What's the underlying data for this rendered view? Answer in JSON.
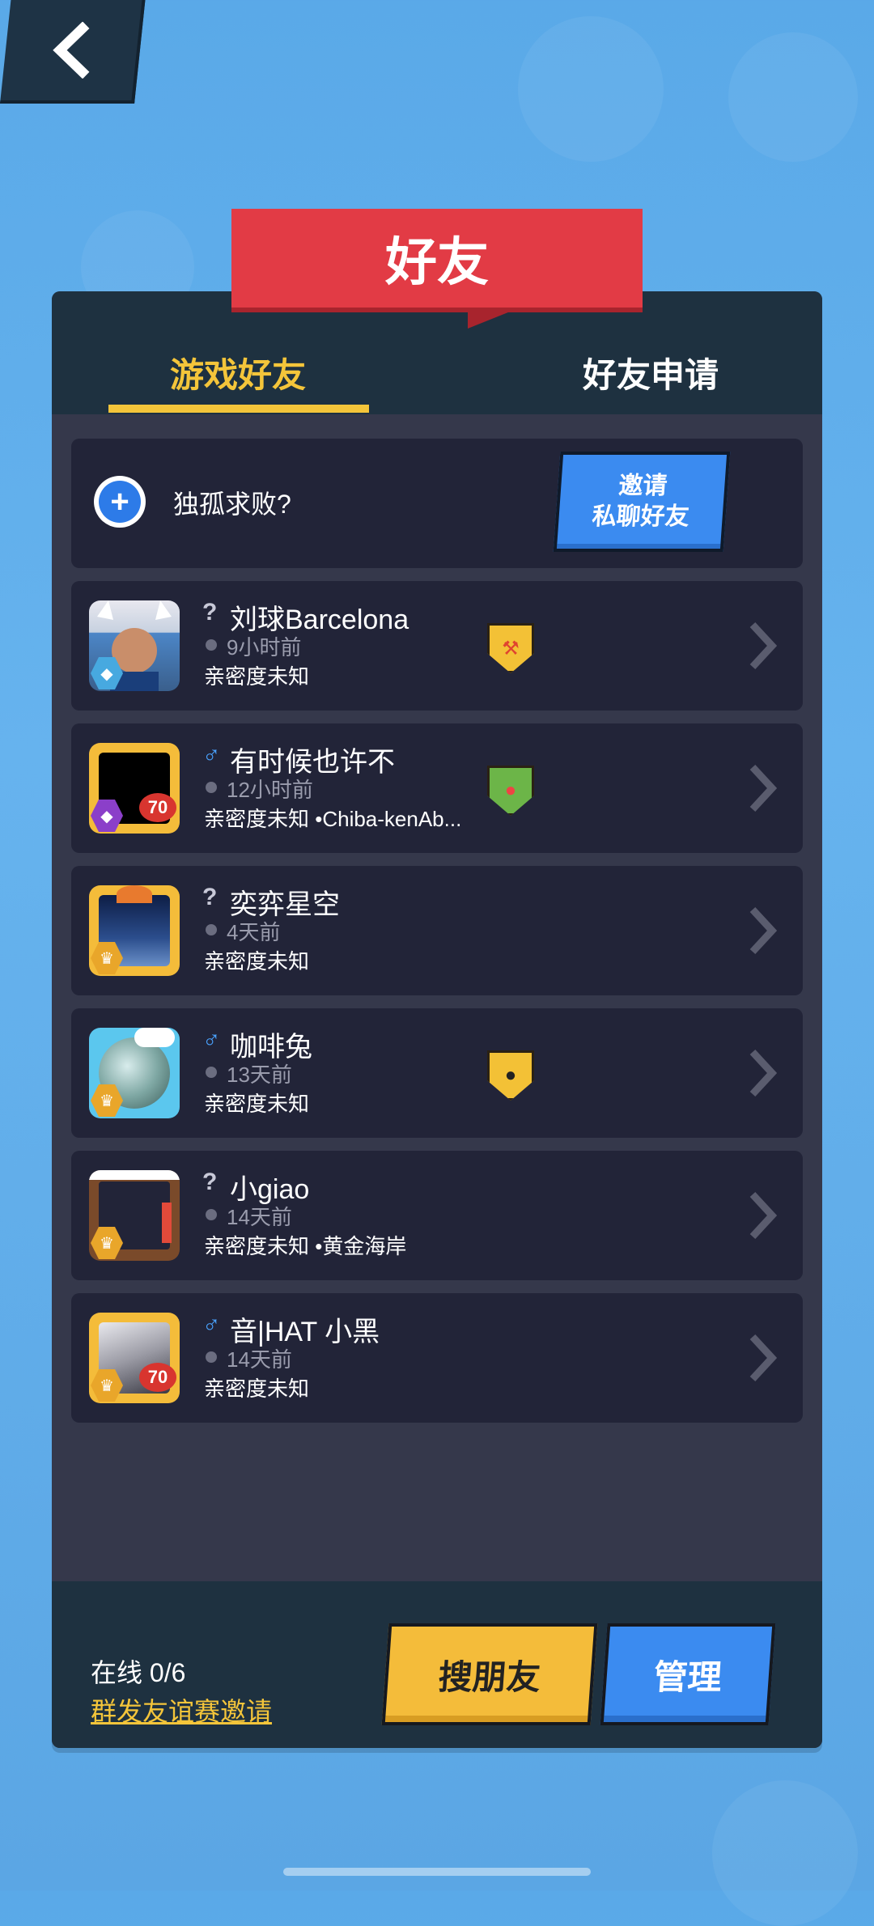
{
  "header": {
    "title": "好友"
  },
  "tabs": [
    {
      "label": "游戏好友",
      "active": true
    },
    {
      "label": "好友申请",
      "active": false
    }
  ],
  "invite": {
    "prompt": "独孤求败?",
    "button_line1": "邀请",
    "button_line2": "私聊好友"
  },
  "friends": [
    {
      "gender": "?",
      "name": "刘球Barcelona",
      "time": "9小时前",
      "intimacy": "亲密度未知",
      "avatar_icon": "player-avatar-cat-hat-icon",
      "badge_icon": "hammer-shield-icon"
    },
    {
      "gender": "♂",
      "name": "有时候也许不",
      "time": "12小时前",
      "intimacy": "亲密度未知 •Chiba-kenAb...",
      "avatar_icon": "black-avatar-icon",
      "badge_icon": "ladybug-shield-icon"
    },
    {
      "gender": "?",
      "name": "奕弈星空",
      "time": "4天前",
      "intimacy": "亲密度未知",
      "avatar_icon": "night-city-avatar-icon",
      "badge_icon": ""
    },
    {
      "gender": "♂",
      "name": "咖啡兔",
      "time": "13天前",
      "intimacy": "亲密度未知",
      "avatar_icon": "crystal-ball-avatar-icon",
      "badge_icon": "sheep-shield-icon"
    },
    {
      "gender": "?",
      "name": "小giao",
      "time": "14天前",
      "intimacy": "亲密度未知 •黄金海岸",
      "avatar_icon": "birthday-frame-avatar-icon",
      "badge_icon": ""
    },
    {
      "gender": "♂",
      "name": "音|HAT 小黑",
      "time": "14天前",
      "intimacy": "亲密度未知",
      "avatar_icon": "silver-hair-avatar-icon",
      "badge_icon": ""
    }
  ],
  "footer": {
    "online": "在线 0/6",
    "group_invite": "群发友谊赛邀请",
    "search_button": "搜朋友",
    "manage_button": "管理"
  },
  "colors": {
    "accent": "#f4c53a",
    "banner": "#e23b45",
    "button_blue": "#3b8bf0",
    "panel": "#35384b"
  }
}
